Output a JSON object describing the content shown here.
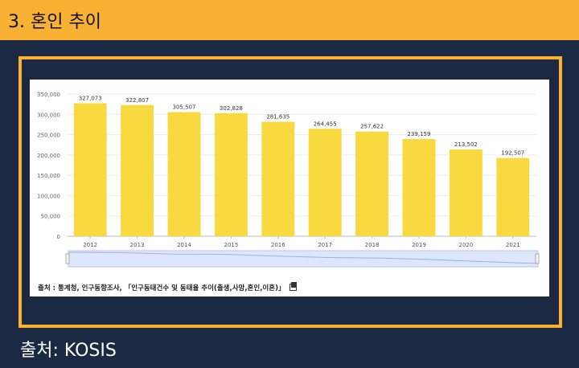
{
  "header": {
    "title": "3. 혼인 추이"
  },
  "chart_data": {
    "type": "bar",
    "categories": [
      "2012",
      "2013",
      "2014",
      "2015",
      "2016",
      "2017",
      "2018",
      "2019",
      "2020",
      "2021"
    ],
    "values": [
      327073,
      322807,
      305507,
      302828,
      281635,
      264455,
      257622,
      239159,
      213502,
      192507
    ],
    "value_labels": [
      "327,073",
      "322,807",
      "305,507",
      "302,828",
      "281,635",
      "264,455",
      "257,622",
      "239,159",
      "213,502",
      "192,507"
    ],
    "y_ticks": [
      0,
      50000,
      100000,
      150000,
      200000,
      250000,
      300000,
      350000
    ],
    "y_tick_labels": [
      "0",
      "50,000",
      "100,000",
      "150,000",
      "200,000",
      "250,000",
      "300,000",
      "350,000"
    ],
    "ylim": [
      0,
      350000
    ],
    "grid": true,
    "bar_color": "#f8d93f",
    "title": "",
    "xlabel": "",
    "ylabel": ""
  },
  "chart_source": "출처 : 통계청, 인구동향조사, 「인구동태건수 및 동태율 추이(출생,사망,혼인,이혼)」",
  "footer": {
    "source": "출처: KOSIS"
  },
  "colors": {
    "header_bg": "#f8b133",
    "page_bg": "#1b2a42",
    "frame": "#f8b133"
  }
}
